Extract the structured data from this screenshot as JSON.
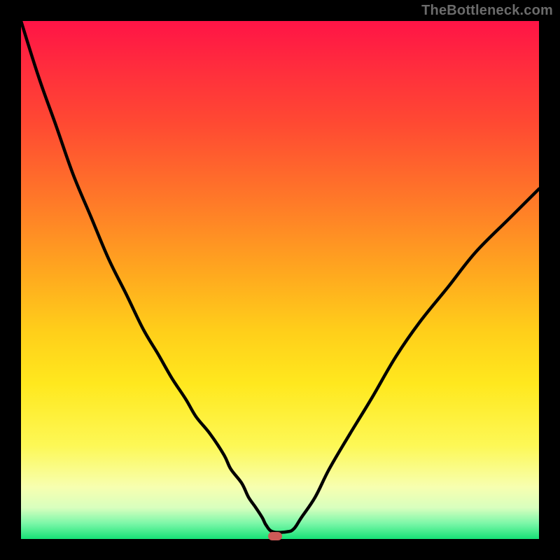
{
  "watermark": "TheBottleneck.com",
  "colors": {
    "frame_bg": "#000000",
    "gradient_top": "#ff1446",
    "gradient_bottom": "#16e276",
    "curve_stroke": "#000000",
    "marker_fill": "#cc5a57"
  },
  "chart_data": {
    "type": "line",
    "title": "",
    "xlabel": "",
    "ylabel": "",
    "xlim": [
      0,
      100
    ],
    "ylim": [
      0,
      100
    ],
    "grid": false,
    "note": "Approximate V-shaped curve; minimum near x≈49, y≈0. Values estimated to ~1% precision from pixel positions.",
    "marker": {
      "x_pct": 49,
      "y_pct": 0.6
    },
    "series": [
      {
        "name": "curve",
        "x": [
          0.0,
          3.4,
          6.8,
          10.1,
          13.5,
          16.9,
          20.3,
          23.6,
          26.4,
          29.1,
          31.8,
          33.8,
          36.5,
          39.2,
          40.5,
          42.6,
          43.9,
          45.3,
          46.6,
          47.3,
          48.6,
          51.4,
          52.7,
          54.1,
          56.8,
          59.5,
          63.5,
          67.6,
          72.3,
          77.0,
          82.4,
          87.8,
          94.6,
          100.0
        ],
        "y": [
          100.0,
          89.2,
          79.7,
          70.3,
          62.2,
          54.1,
          47.3,
          40.5,
          35.8,
          31.1,
          27.0,
          23.6,
          20.3,
          16.2,
          13.5,
          10.8,
          8.1,
          6.1,
          4.1,
          2.7,
          1.4,
          1.4,
          2.0,
          4.1,
          8.1,
          13.5,
          20.3,
          27.0,
          35.1,
          41.9,
          48.6,
          55.4,
          62.2,
          67.6
        ]
      }
    ]
  }
}
